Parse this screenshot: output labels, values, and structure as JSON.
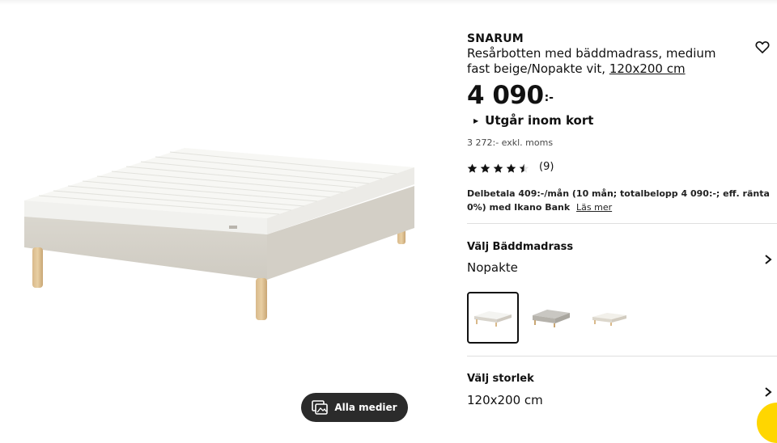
{
  "product": {
    "name": "SNARUM",
    "description": "Resårbotten med bäddmadrass, medium fast beige/Nopakte vit,",
    "size_link": "120x200 cm",
    "price_amount": "4 090",
    "price_currency": ":-",
    "availability": "Utgår inom kort",
    "vat_text": "3 272:- exkl. moms",
    "rating_count": "(9)",
    "rating_value": 4.5,
    "rating_max": 5
  },
  "finance": {
    "text": "Delbetala 409:-/mån (10 mån; totalbelopp 4 090:-; eff. ränta 0%) med Ikano Bank",
    "link": "Läs mer"
  },
  "mattress_section": {
    "title": "Välj Bäddmadrass",
    "value": "Nopakte",
    "options_count": 3,
    "selected_index": 0
  },
  "size_section": {
    "title": "Välj storlek",
    "value": "120x200 cm"
  },
  "media": {
    "button_label": "Alla medier"
  },
  "icons": {
    "favorite": "heart-icon",
    "media": "gallery-icon",
    "chevron": "chevron-right-icon",
    "availability": "triangle-right-icon"
  },
  "colors": {
    "text": "#111111",
    "button_dark": "#2b2b2b",
    "chat_yellow": "#ffd600",
    "divider": "#dfdfdf"
  }
}
